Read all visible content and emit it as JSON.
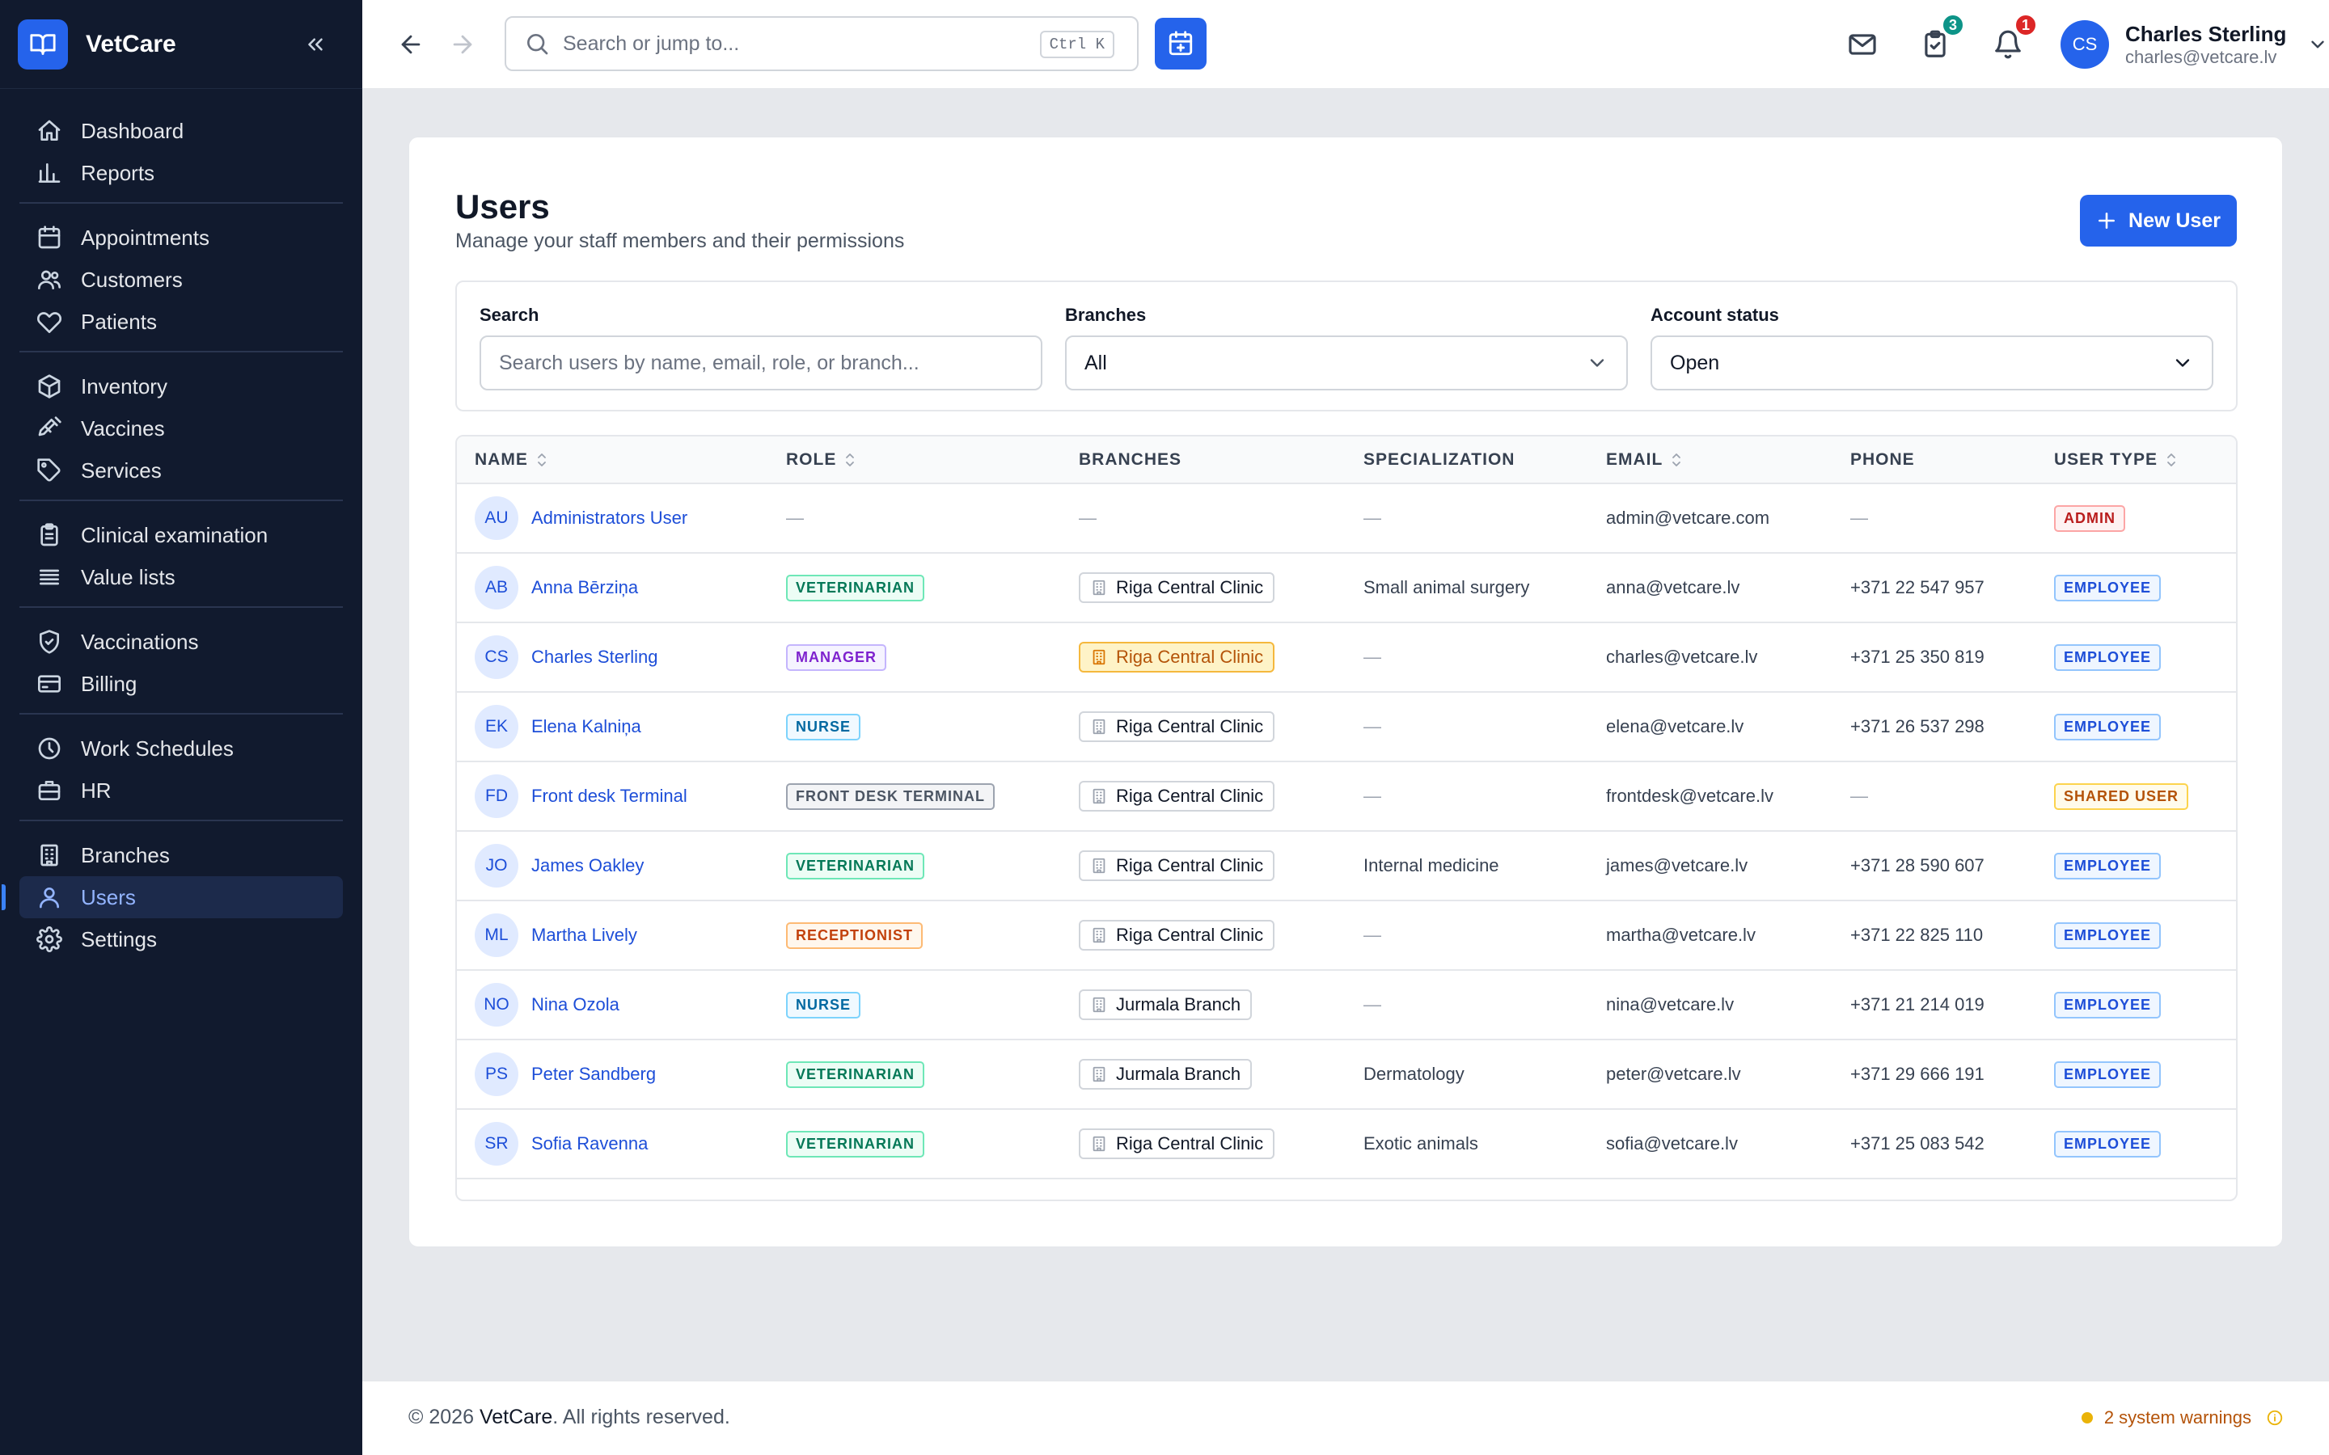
{
  "app": {
    "name": "VetCare"
  },
  "sidebar": {
    "groups": [
      [
        {
          "label": "Dashboard",
          "icon": "home-icon"
        },
        {
          "label": "Reports",
          "icon": "bar-chart-icon"
        }
      ],
      [
        {
          "label": "Appointments",
          "icon": "calendar-icon"
        },
        {
          "label": "Customers",
          "icon": "users-icon"
        },
        {
          "label": "Patients",
          "icon": "heart-icon"
        }
      ],
      [
        {
          "label": "Inventory",
          "icon": "box-icon"
        },
        {
          "label": "Vaccines",
          "icon": "syringe-icon"
        },
        {
          "label": "Services",
          "icon": "tag-icon"
        }
      ],
      [
        {
          "label": "Clinical examination",
          "icon": "clipboard-icon"
        },
        {
          "label": "Value lists",
          "icon": "list-icon"
        }
      ],
      [
        {
          "label": "Vaccinations",
          "icon": "shield-check-icon"
        },
        {
          "label": "Billing",
          "icon": "credit-card-icon"
        }
      ],
      [
        {
          "label": "Work Schedules",
          "icon": "clock-icon"
        },
        {
          "label": "HR",
          "icon": "briefcase-icon"
        }
      ],
      [
        {
          "label": "Branches",
          "icon": "building-icon"
        },
        {
          "label": "Users",
          "icon": "user-icon",
          "active": true
        },
        {
          "label": "Settings",
          "icon": "gear-icon"
        }
      ]
    ]
  },
  "topbar": {
    "search_placeholder": "Search or jump to...",
    "shortcut": "Ctrl K",
    "tasks_badge": "3",
    "notifications_badge": "1",
    "user": {
      "initials": "CS",
      "name": "Charles Sterling",
      "email": "charles@vetcare.lv"
    }
  },
  "page": {
    "title": "Users",
    "subtitle": "Manage your staff members and their permissions",
    "new_user_label": "New User"
  },
  "filters": {
    "search_label": "Search",
    "search_placeholder": "Search users by name, email, role, or branch...",
    "branches_label": "Branches",
    "branches_value": "All",
    "status_label": "Account status",
    "status_value": "Open"
  },
  "table": {
    "columns": [
      {
        "label": "NAME",
        "sortable": true
      },
      {
        "label": "ROLE",
        "sortable": true
      },
      {
        "label": "BRANCHES",
        "sortable": false
      },
      {
        "label": "SPECIALIZATION",
        "sortable": false
      },
      {
        "label": "EMAIL",
        "sortable": true
      },
      {
        "label": "PHONE",
        "sortable": false
      },
      {
        "label": "USER TYPE",
        "sortable": true
      }
    ],
    "rows": [
      {
        "initials": "AU",
        "name": "Administrators User",
        "role": "",
        "branch": "",
        "branch_hl": false,
        "specialization": "",
        "email": "admin@vetcare.com",
        "phone": "",
        "type": "ADMIN"
      },
      {
        "initials": "AB",
        "name": "Anna Bērziņa",
        "role": "VETERINARIAN",
        "branch": "Riga Central Clinic",
        "branch_hl": false,
        "specialization": "Small animal surgery",
        "email": "anna@vetcare.lv",
        "phone": "+371 22 547 957",
        "type": "EMPLOYEE"
      },
      {
        "initials": "CS",
        "name": "Charles Sterling",
        "role": "MANAGER",
        "branch": "Riga Central Clinic",
        "branch_hl": true,
        "specialization": "",
        "email": "charles@vetcare.lv",
        "phone": "+371 25 350 819",
        "type": "EMPLOYEE"
      },
      {
        "initials": "EK",
        "name": "Elena Kalniņa",
        "role": "NURSE",
        "branch": "Riga Central Clinic",
        "branch_hl": false,
        "specialization": "",
        "email": "elena@vetcare.lv",
        "phone": "+371 26 537 298",
        "type": "EMPLOYEE"
      },
      {
        "initials": "FD",
        "name": "Front desk Terminal",
        "role": "FRONT DESK TERMINAL",
        "branch": "Riga Central Clinic",
        "branch_hl": false,
        "specialization": "",
        "email": "frontdesk@vetcare.lv",
        "phone": "",
        "type": "SHARED USER"
      },
      {
        "initials": "JO",
        "name": "James Oakley",
        "role": "VETERINARIAN",
        "branch": "Riga Central Clinic",
        "branch_hl": false,
        "specialization": "Internal medicine",
        "email": "james@vetcare.lv",
        "phone": "+371 28 590 607",
        "type": "EMPLOYEE"
      },
      {
        "initials": "ML",
        "name": "Martha Lively",
        "role": "RECEPTIONIST",
        "branch": "Riga Central Clinic",
        "branch_hl": false,
        "specialization": "",
        "email": "martha@vetcare.lv",
        "phone": "+371 22 825 110",
        "type": "EMPLOYEE"
      },
      {
        "initials": "NO",
        "name": "Nina Ozola",
        "role": "NURSE",
        "branch": "Jurmala Branch",
        "branch_hl": false,
        "specialization": "",
        "email": "nina@vetcare.lv",
        "phone": "+371 21 214 019",
        "type": "EMPLOYEE"
      },
      {
        "initials": "PS",
        "name": "Peter Sandberg",
        "role": "VETERINARIAN",
        "branch": "Jurmala Branch",
        "branch_hl": false,
        "specialization": "Dermatology",
        "email": "peter@vetcare.lv",
        "phone": "+371 29 666 191",
        "type": "EMPLOYEE"
      },
      {
        "initials": "SR",
        "name": "Sofia Ravenna",
        "role": "VETERINARIAN",
        "branch": "Riga Central Clinic",
        "branch_hl": false,
        "specialization": "Exotic animals",
        "email": "sofia@vetcare.lv",
        "phone": "+371 25 083 542",
        "type": "EMPLOYEE"
      }
    ],
    "empty_marker": "—"
  },
  "colors": {
    "accent": "#2563eb",
    "pill": {
      "VETERINARIAN": {
        "fg": "#047857",
        "bg": "#ecfdf5",
        "bd": "#6ee7b7"
      },
      "MANAGER": {
        "fg": "#7e22ce",
        "bg": "#f5f3ff",
        "bd": "#c4b5fd"
      },
      "NURSE": {
        "fg": "#0369a1",
        "bg": "#f0f9ff",
        "bd": "#7dd3fc"
      },
      "FRONT DESK TERMINAL": {
        "fg": "#4b5563",
        "bg": "#f3f4f6",
        "bd": "#9ca3af"
      },
      "RECEPTIONIST": {
        "fg": "#c2410c",
        "bg": "#fff7ed",
        "bd": "#fdba74"
      },
      "ADMIN": {
        "fg": "#b91c1c",
        "bg": "#fef2f2",
        "bd": "#fca5a5"
      },
      "EMPLOYEE": {
        "fg": "#1d4ed8",
        "bg": "#eff6ff",
        "bd": "#93c5fd"
      },
      "SHARED USER": {
        "fg": "#b45309",
        "bg": "#fffbeb",
        "bd": "#fcd34d"
      }
    }
  },
  "footer": {
    "copyright_prefix": "© 2026 ",
    "copyright_brand": "VetCare",
    "copyright_suffix": ". All rights reserved.",
    "warnings": "2 system warnings"
  }
}
